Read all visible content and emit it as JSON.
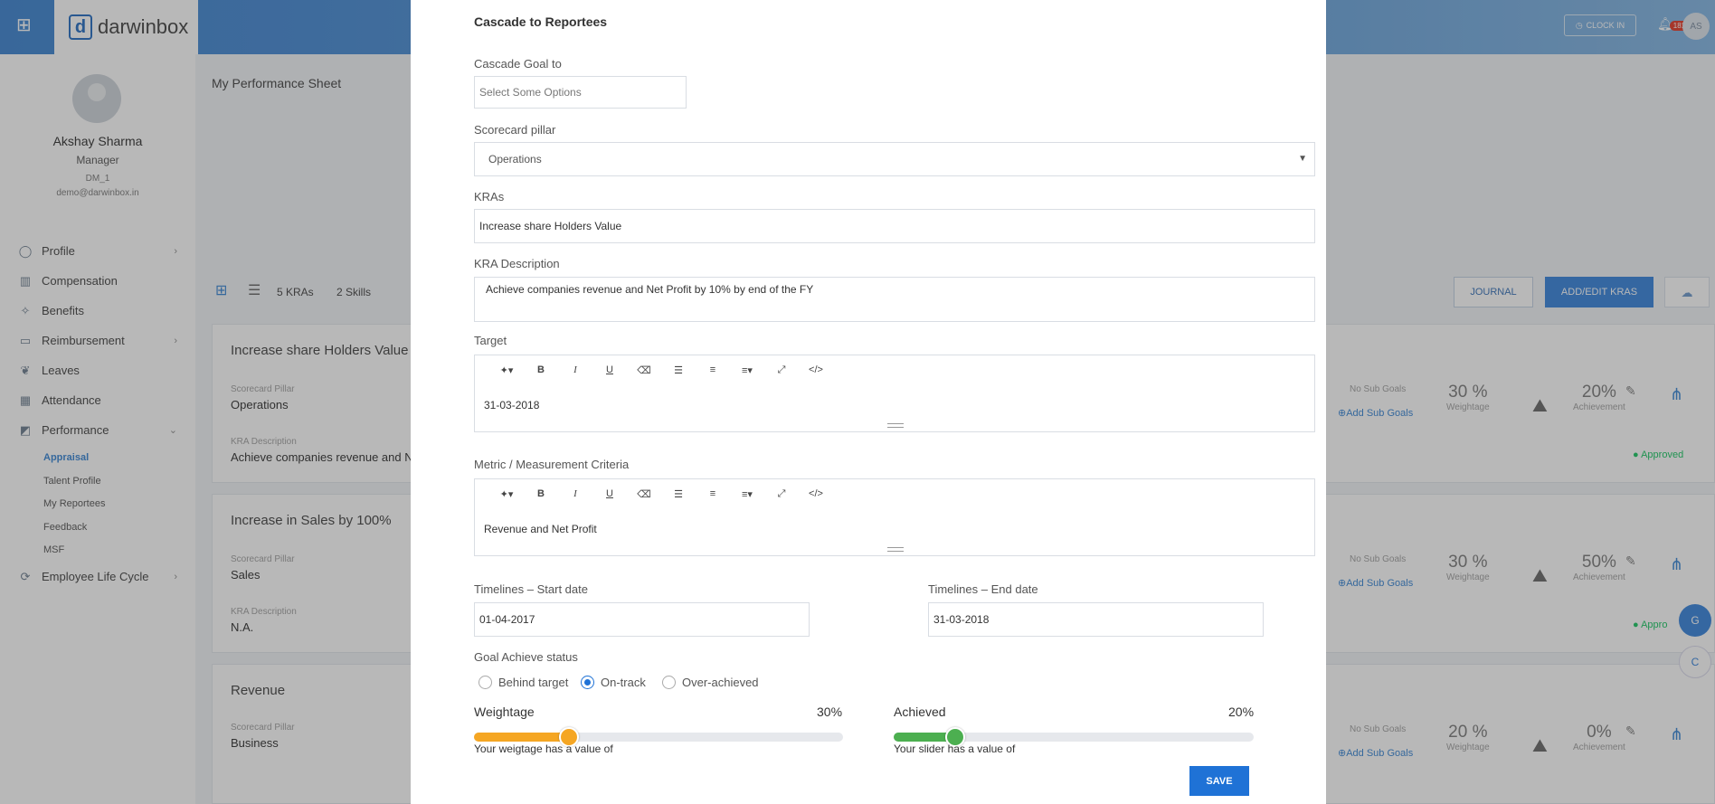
{
  "topbar": {
    "logo_text": "darwinbox",
    "logo_letter": "d",
    "clock_in": "CLOCK IN",
    "notification_count": "181",
    "avatar_initials": "AS"
  },
  "sidebar": {
    "user": {
      "name": "Akshay Sharma",
      "role": "Manager",
      "code": "DM_1",
      "email": "demo@darwinbox.in"
    },
    "items": [
      {
        "label": "Profile",
        "icon": "user-icon"
      },
      {
        "label": "Compensation",
        "icon": "bar-chart-icon"
      },
      {
        "label": "Benefits",
        "icon": "gift-icon"
      },
      {
        "label": "Reimbursement",
        "icon": "wallet-icon"
      },
      {
        "label": "Leaves",
        "icon": "leaf-icon"
      },
      {
        "label": "Attendance",
        "icon": "calendar-icon"
      },
      {
        "label": "Performance",
        "icon": "trend-icon"
      },
      {
        "label": "Employee Life Cycle",
        "icon": "cycle-icon"
      }
    ],
    "performance_sub": [
      "Appraisal",
      "Talent Profile",
      "My Reportees",
      "Feedback",
      "MSF"
    ]
  },
  "main": {
    "page_title": "My Performance Sheet",
    "kra_count": "5 KRAs",
    "skill_count": "2 Skills",
    "journal_label": "JOURNAL",
    "add_edit_label": "ADD/EDIT KRAS",
    "cards": [
      {
        "title": "Increase share Holders Value",
        "pillar_label": "Scorecard Pillar",
        "pillar": "Operations",
        "desc_label": "KRA Description",
        "desc": "Achieve companies revenue and N",
        "no_sub": "No Sub Goals",
        "add_sub": "Add Sub Goals",
        "weightage": "30 %",
        "weightage_label": "Weightage",
        "achievement": "20%",
        "achievement_label": "Achievement",
        "status": "Approved"
      },
      {
        "title": "Increase in Sales by 100%",
        "pillar_label": "Scorecard Pillar",
        "pillar": "Sales",
        "desc_label": "KRA Description",
        "desc": "N.A.",
        "no_sub": "No Sub Goals",
        "add_sub": "Add Sub Goals",
        "weightage": "30 %",
        "weightage_label": "Weightage",
        "achievement": "50%",
        "achievement_label": "Achievement",
        "status": "Appro"
      },
      {
        "title": "Revenue",
        "pillar_label": "Scorecard Pillar",
        "pillar": "Business",
        "no_sub": "No Sub Goals",
        "add_sub": "Add Sub Goals",
        "weightage": "20 %",
        "weightage_label": "Weightage",
        "achievement": "0%",
        "achievement_label": "Achievement"
      }
    ],
    "fab_g": "G",
    "fab_c": "C"
  },
  "modal": {
    "title": "Cascade to Reportees",
    "cascade_label": "Cascade Goal to",
    "cascade_placeholder": "Select Some Options",
    "pillar_label": "Scorecard pillar",
    "pillar_value": "Operations",
    "kras_label": "KRAs",
    "kras_value": "Increase share Holders Value",
    "desc_label": "KRA Description",
    "desc_value": "Achieve companies revenue and Net Profit by 10% by end of the FY",
    "target_label": "Target",
    "target_value": "31-03-2018",
    "metric_label": "Metric / Measurement Criteria",
    "metric_value": "Revenue and Net Profit",
    "start_label": "Timelines – Start date",
    "start_value": "01-04-2017",
    "end_label": "Timelines – End date",
    "end_value": "31-03-2018",
    "status_label": "Goal Achieve status",
    "status_options": [
      "Behind target",
      "On-track",
      "Over-achieved"
    ],
    "status_selected": "On-track",
    "weightage": {
      "title": "Weightage",
      "value_text": "30%",
      "value": 0.3,
      "note": "Your weigtage has a value of",
      "color": "#f5a623"
    },
    "achieved": {
      "title": "Achieved",
      "value_text": "20%",
      "value": 0.2,
      "note": "Your slider has a value of",
      "color": "#4caf50"
    },
    "save_label": "SAVE",
    "toolbar_icons": [
      "magic-icon",
      "bold-icon",
      "italic-icon",
      "underline-icon",
      "eraser-icon",
      "bullet-list-icon",
      "numbered-list-icon",
      "align-icon",
      "fullscreen-icon",
      "code-icon"
    ]
  }
}
